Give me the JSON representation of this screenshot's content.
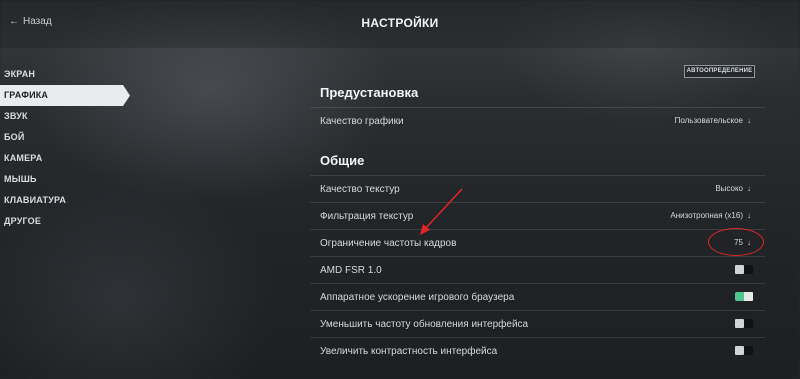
{
  "header": {
    "back_label": "Назад",
    "title": "НАСТРОЙКИ"
  },
  "sidebar": {
    "items": [
      {
        "label": "ЭКРАН"
      },
      {
        "label": "ГРАФИКА"
      },
      {
        "label": "ЗВУК"
      },
      {
        "label": "БОЙ"
      },
      {
        "label": "КАМЕРА"
      },
      {
        "label": "МЫШЬ"
      },
      {
        "label": "КЛАВИАТУРА"
      },
      {
        "label": "ДРУГОЕ"
      }
    ],
    "active_index": 1
  },
  "content": {
    "autodetect_label": "АВТООПРЕДЕЛЕНИЕ",
    "preset_section": {
      "title": "Предустановка",
      "graphics_quality": {
        "label": "Качество графики",
        "value": "Пользовательское"
      }
    },
    "general_section": {
      "title": "Общие",
      "texture_quality": {
        "label": "Качество текстур",
        "value": "Высоко"
      },
      "texture_filtering": {
        "label": "Фильтрация текстур",
        "value": "Анизотропная (x16)"
      },
      "frame_limit": {
        "label": "Ограничение частоты кадров",
        "value": "75"
      },
      "amd_fsr": {
        "label": "AMD FSR 1.0",
        "enabled": false
      },
      "hw_acceleration": {
        "label": "Аппаратное ускорение игрового браузера",
        "enabled": true
      },
      "reduce_ui_refresh": {
        "label": "Уменьшить частоту обновления интерфейса",
        "enabled": false
      },
      "increase_contrast": {
        "label": "Увеличить контрастность интерфейса",
        "enabled": false
      }
    }
  },
  "icons": {
    "back": "arrow-left-icon",
    "dropdown": "chevron-down-icon"
  },
  "colors": {
    "toggle_on": "#4fc592",
    "annotation": "#e3252a",
    "active_tab_bg": "#e9ebec"
  }
}
